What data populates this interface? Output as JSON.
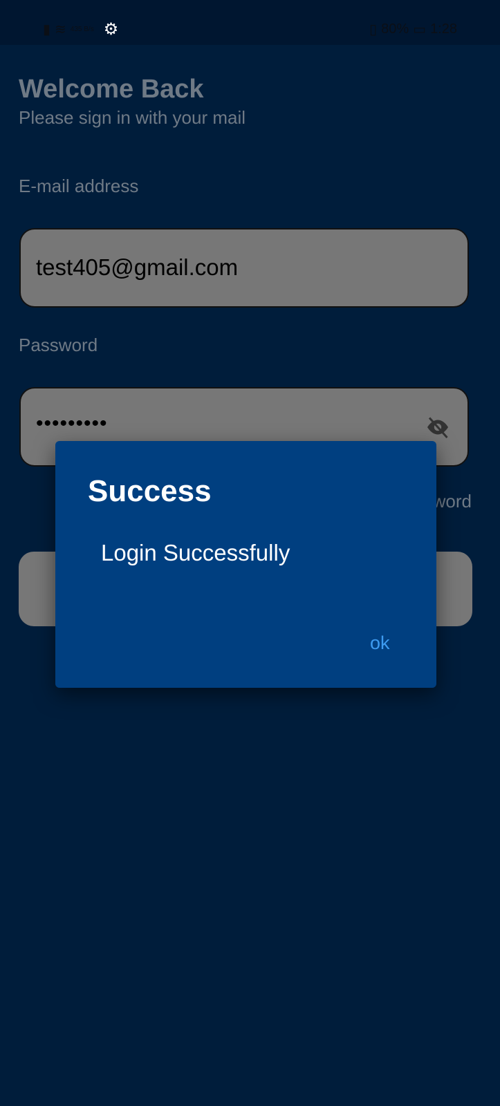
{
  "status_bar": {
    "network_speed": "435 B/s",
    "battery": "80%",
    "time": "1:28"
  },
  "header": {
    "title": "Welcome Back",
    "subtitle": "Please sign in with your mail"
  },
  "form": {
    "email_label": "E-mail address",
    "email_value": "test405@gmail.com",
    "password_label": "Password",
    "password_value": "•••••••••",
    "forgot_password": "Forgot Password"
  },
  "dialog": {
    "title": "Success",
    "message": "Login Successfully",
    "ok_label": "ok"
  },
  "colors": {
    "background": "#001d3b",
    "dialog": "#003f80",
    "accent": "#3e9bf0"
  }
}
